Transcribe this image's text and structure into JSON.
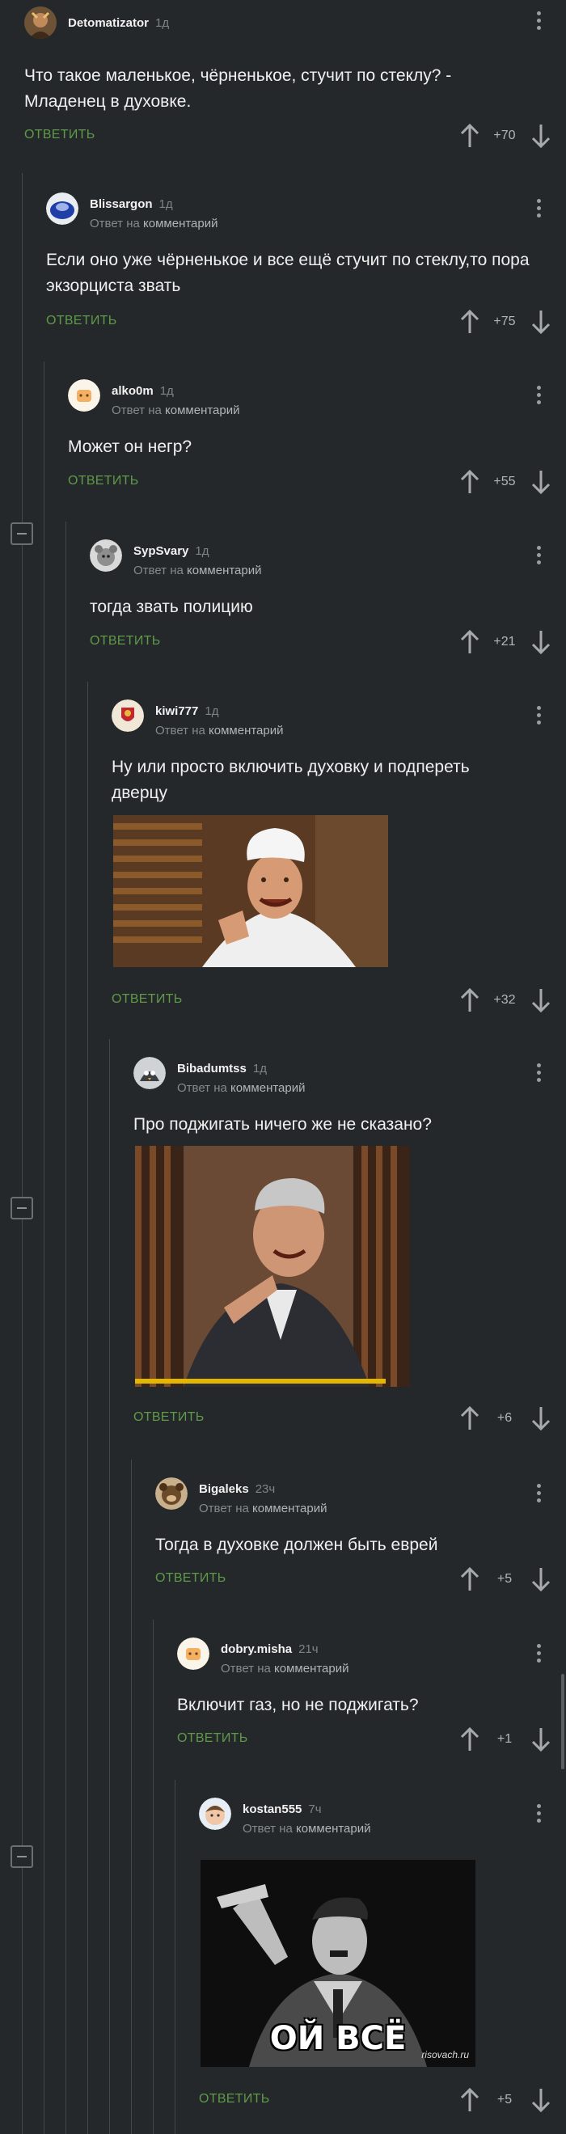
{
  "reply_label": "ОТВЕТИТЬ",
  "reply_to_prefix": "Ответ на",
  "reply_to_link": "комментарий",
  "comments": [
    {
      "user": "Detomatizator",
      "time": "1д",
      "text": "Что такое маленькое, чёрненькое, стучит по стеклу? - Младенец в духовке.",
      "score": "+70"
    },
    {
      "user": "Blissargon",
      "time": "1д",
      "text": "Если оно уже чёрненькое и все ещё стучит по стеклу,то пора экзорциста звать",
      "score": "+75"
    },
    {
      "user": "alko0m",
      "time": "1д",
      "text": "Может он негр?",
      "score": "+55"
    },
    {
      "user": "SypSvary",
      "time": "1д",
      "text": "тогда звать полицию",
      "score": "+21"
    },
    {
      "user": "kiwi777",
      "time": "1д",
      "text": "Ну или просто включить духовку и подпереть дверцу",
      "score": "+32"
    },
    {
      "user": "Bibadumtss",
      "time": "1д",
      "text": "Про поджигать ничего же не сказано?",
      "score": "+6"
    },
    {
      "user": "Bigaleks",
      "time": "23ч",
      "text": "Тогда в духовке должен быть еврей",
      "score": "+5"
    },
    {
      "user": "dobry.misha",
      "time": "21ч",
      "text": "Включит газ, но не поджигать?",
      "score": "+1"
    },
    {
      "user": "kostan555",
      "time": "7ч",
      "text": "",
      "score": "+5"
    }
  ],
  "meme_caption": "ОЙ ВСЁ",
  "meme_watermark": "risovach.ru",
  "colors": {
    "background": "#25282b",
    "reply": "#5e9a49",
    "text": "#f0f0f0",
    "meta": "#85898d"
  }
}
